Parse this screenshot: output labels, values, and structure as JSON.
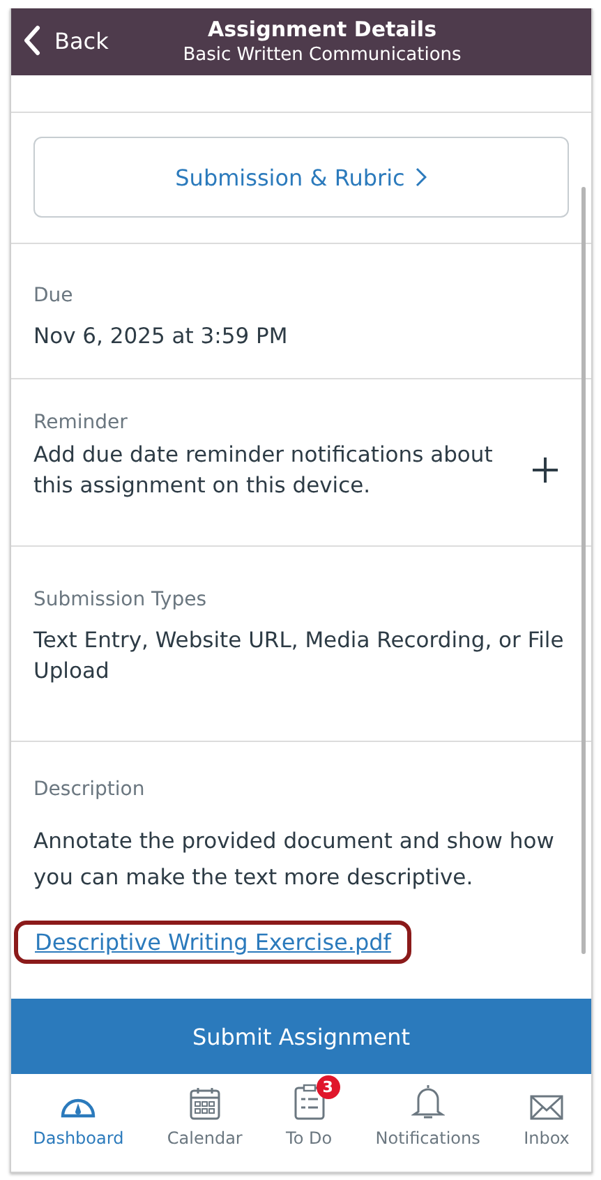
{
  "header": {
    "back_label": "Back",
    "title": "Assignment Details",
    "subtitle": "Basic Written Communications"
  },
  "submission_button": {
    "label": "Submission & Rubric"
  },
  "sections": [
    {
      "kind": "date",
      "label": "Due",
      "text": "Nov 6, 2025 at 3:59 PM"
    },
    {
      "kind": "reminder",
      "label": "Reminder",
      "text": "Add due date reminder notifications about this assignment on this device."
    },
    {
      "kind": "text",
      "label": "Submission Types",
      "text": "Text Entry, Website URL, Media Recording, or File Upload"
    },
    {
      "kind": "description",
      "label": "Description",
      "text": "Annotate the provided document and show how you can make the text more descriptive.",
      "attachment": {
        "label": "Descriptive Writing Exercise.pdf",
        "highlighted": true
      }
    }
  ],
  "submit_button": {
    "label": "Submit Assignment"
  },
  "tab_bar": [
    {
      "kind": "dashboard",
      "label": "Dashboard",
      "selected": true
    },
    {
      "kind": "calendar",
      "label": "Calendar",
      "selected": false
    },
    {
      "kind": "todo",
      "label": "To Do",
      "selected": false,
      "badge": "3"
    },
    {
      "kind": "notifications",
      "label": "Notifications",
      "selected": false
    },
    {
      "kind": "inbox",
      "label": "Inbox",
      "selected": false
    }
  ]
}
